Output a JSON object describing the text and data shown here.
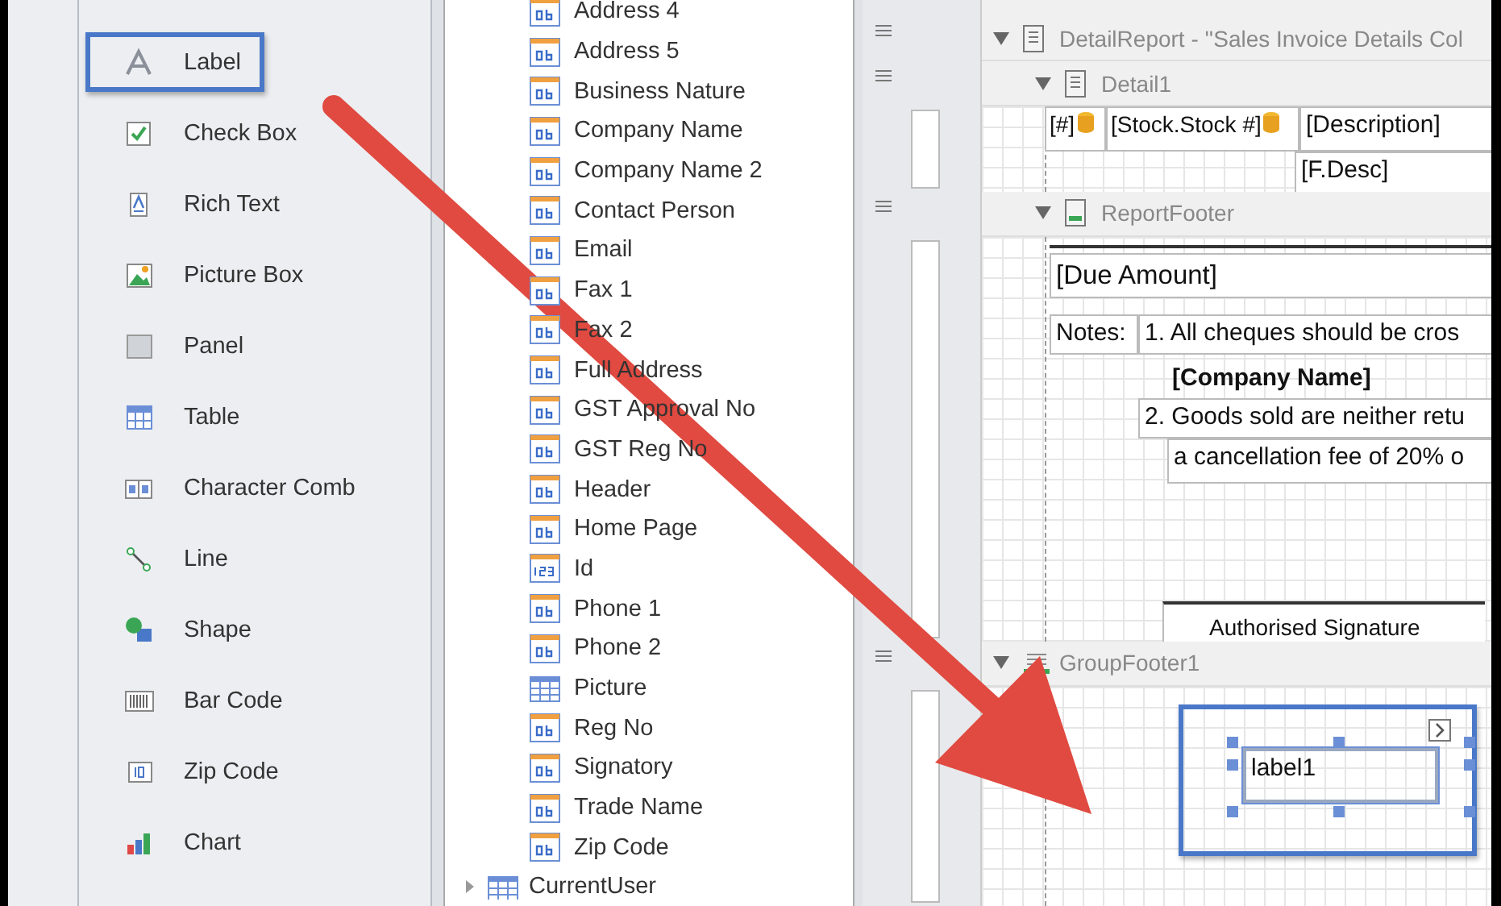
{
  "toolbox": {
    "items": [
      {
        "label": "Label",
        "kind": "label",
        "selected": true
      },
      {
        "label": "Check Box",
        "kind": "checkbox",
        "selected": false
      },
      {
        "label": "Rich Text",
        "kind": "richtext",
        "selected": false
      },
      {
        "label": "Picture Box",
        "kind": "picture",
        "selected": false
      },
      {
        "label": "Panel",
        "kind": "panel",
        "selected": false
      },
      {
        "label": "Table",
        "kind": "table",
        "selected": false
      },
      {
        "label": "Character Comb",
        "kind": "comb",
        "selected": false
      },
      {
        "label": "Line",
        "kind": "line",
        "selected": false
      },
      {
        "label": "Shape",
        "kind": "shape",
        "selected": false
      },
      {
        "label": "Bar Code",
        "kind": "barcode",
        "selected": false
      },
      {
        "label": "Zip Code",
        "kind": "zipcode",
        "selected": false
      },
      {
        "label": "Chart",
        "kind": "chart",
        "selected": false
      }
    ]
  },
  "field_list": {
    "fields": [
      {
        "name": "Address 4",
        "kind": "text"
      },
      {
        "name": "Address 5",
        "kind": "text"
      },
      {
        "name": "Business Nature",
        "kind": "text"
      },
      {
        "name": "Company Name",
        "kind": "text"
      },
      {
        "name": "Company Name 2",
        "kind": "text"
      },
      {
        "name": "Contact Person",
        "kind": "text"
      },
      {
        "name": "Email",
        "kind": "text"
      },
      {
        "name": "Fax 1",
        "kind": "text"
      },
      {
        "name": "Fax 2",
        "kind": "text"
      },
      {
        "name": "Full Address",
        "kind": "text"
      },
      {
        "name": "GST Approval No",
        "kind": "text"
      },
      {
        "name": "GST Reg No",
        "kind": "text"
      },
      {
        "name": "Header",
        "kind": "text"
      },
      {
        "name": "Home Page",
        "kind": "text"
      },
      {
        "name": "Id",
        "kind": "number"
      },
      {
        "name": "Phone 1",
        "kind": "text"
      },
      {
        "name": "Phone 2",
        "kind": "text"
      },
      {
        "name": "Picture",
        "kind": "image"
      },
      {
        "name": "Reg No",
        "kind": "text"
      },
      {
        "name": "Signatory",
        "kind": "text"
      },
      {
        "name": "Trade Name",
        "kind": "text"
      },
      {
        "name": "Zip Code",
        "kind": "text"
      }
    ],
    "tables": [
      {
        "name": "CurrentUser",
        "expanded": false
      }
    ]
  },
  "designer": {
    "bands": [
      {
        "title": "DetailReport - ''Sales Invoice Details Col",
        "kind": "detail-report",
        "expanded": true
      },
      {
        "title": "Detail1",
        "kind": "detail",
        "expanded": true,
        "controls": [
          {
            "text": "[#]",
            "kind": "bound"
          },
          {
            "text": "[Stock.Stock #]",
            "kind": "bound"
          },
          {
            "text": "[Description]",
            "kind": "cell"
          },
          {
            "text": "[F.Desc]",
            "kind": "cell"
          }
        ]
      },
      {
        "title": "ReportFooter",
        "kind": "report-footer",
        "expanded": true,
        "controls": [
          {
            "text": "[Due Amount]",
            "kind": "cell"
          },
          {
            "text": "Notes:",
            "kind": "cell"
          },
          {
            "text": "1. All cheques should be cros",
            "kind": "cell"
          },
          {
            "text": "[Company Name]",
            "kind": "bold"
          },
          {
            "text": "2. Goods sold are neither retu",
            "kind": "cell"
          },
          {
            "text": "a cancellation fee of 20% o",
            "kind": "cell"
          },
          {
            "text": "Authorised Signature",
            "kind": "cell"
          }
        ]
      },
      {
        "title": "GroupFooter1",
        "kind": "group-footer",
        "expanded": true,
        "controls": [
          {
            "text": "label1",
            "kind": "selected"
          }
        ]
      }
    ]
  }
}
